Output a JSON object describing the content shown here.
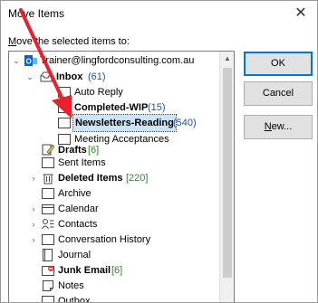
{
  "window": {
    "title": "Move Items"
  },
  "prompt": {
    "prefix": "M",
    "rest": "ove the selected items to:"
  },
  "buttons": {
    "ok": "OK",
    "cancel": "Cancel",
    "new_prefix": "N",
    "new_rest": "ew..."
  },
  "tree": {
    "account": "Trainer@lingfordconsulting.com.au",
    "inbox": {
      "label": "Inbox",
      "count": "(61)"
    },
    "auto_reply": "Auto Reply",
    "completed_wip": {
      "label": "Completed-WIP",
      "count": "(15)"
    },
    "newsletters": {
      "label": "Newsletters-Reading",
      "count": "(540)"
    },
    "meeting_acceptances": "Meeting Acceptances",
    "drafts": {
      "label": "Drafts",
      "count": "[6]"
    },
    "sent_items": "Sent Items",
    "deleted_items": {
      "label": "Deleted Items",
      "count": "[220]"
    },
    "archive": "Archive",
    "calendar": "Calendar",
    "contacts": "Contacts",
    "conversation_history": "Conversation History",
    "journal": "Journal",
    "junk_email": {
      "label": "Junk Email",
      "count": "[6]"
    },
    "notes": "Notes",
    "outbox": "Outbox"
  },
  "colors": {
    "accent": "#0078d7",
    "selection": "#cce4f7",
    "count_blue": "#1a4fb5",
    "count_green": "#2d8a2d",
    "arrow": "#e8212e"
  }
}
